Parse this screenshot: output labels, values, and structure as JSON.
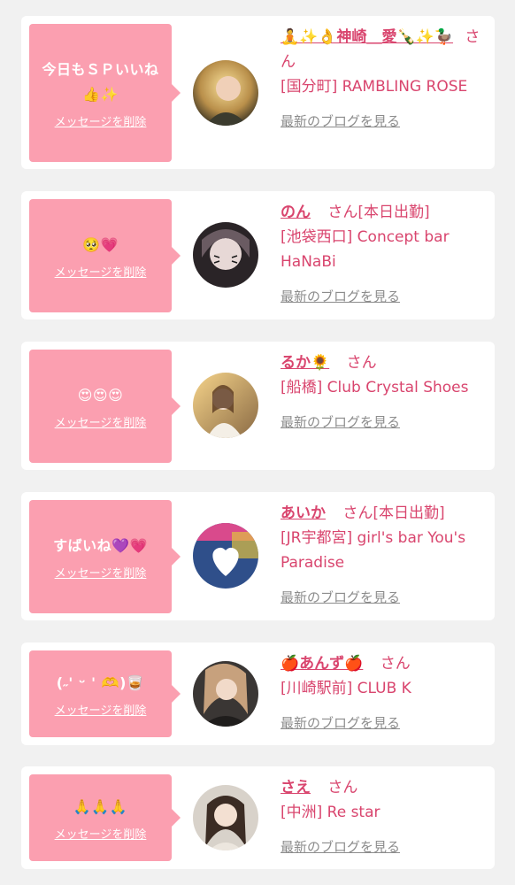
{
  "items": [
    {
      "message": "今日もＳＰいいね👍✨",
      "delete_label": "メッセージを削除",
      "name": "🧘✨👌神崎＿愛🍾✨🦆",
      "suffix": "さん",
      "shop": "[国分町] RAMBLING ROSE",
      "blog_link": "最新のブログを見る",
      "avatar_colors": [
        "#f4d27a",
        "#3c3a2a"
      ]
    },
    {
      "message": "🥺💗",
      "delete_label": "メッセージを削除",
      "name": "のん",
      "suffix": "さん[本日出勤]",
      "shop": "[池袋西口] Concept bar HaNaBi",
      "blog_link": "最新のブログを見る",
      "avatar_colors": [
        "#5a4b52",
        "#1d1a1c"
      ]
    },
    {
      "message": "😍😍😍",
      "delete_label": "メッセージを削除",
      "name": "るか🌻",
      "suffix": "さん",
      "shop": "[船橋] Club Crystal Shoes",
      "blog_link": "最新のブログを見る",
      "avatar_colors": [
        "#f2c77a",
        "#7b5a3c"
      ]
    },
    {
      "message": "すばいね💜💗",
      "delete_label": "メッセージを削除",
      "name": "あいか",
      "suffix": "さん[本日出勤]",
      "shop": "[JR宇都宮] girl's bar You's Paradise",
      "blog_link": "最新のブログを見る",
      "avatar_colors": [
        "#3b6fc4",
        "#e04a8a"
      ]
    },
    {
      "message": "(˶' ᵕ ' 🫶)🥃",
      "delete_label": "メッセージを削除",
      "name": "🍎あんず🍎",
      "suffix": "さん",
      "shop": "[川崎駅前] CLUB K",
      "blog_link": "最新のブログを見る",
      "avatar_colors": [
        "#c9a27c",
        "#2d2a2a"
      ]
    },
    {
      "message": "🙏🙏🙏",
      "delete_label": "メッセージを削除",
      "name": "さえ",
      "suffix": "さん",
      "shop": "[中洲] Re star",
      "blog_link": "最新のブログを見る",
      "avatar_colors": [
        "#d9d3cc",
        "#3a2e28"
      ]
    }
  ]
}
